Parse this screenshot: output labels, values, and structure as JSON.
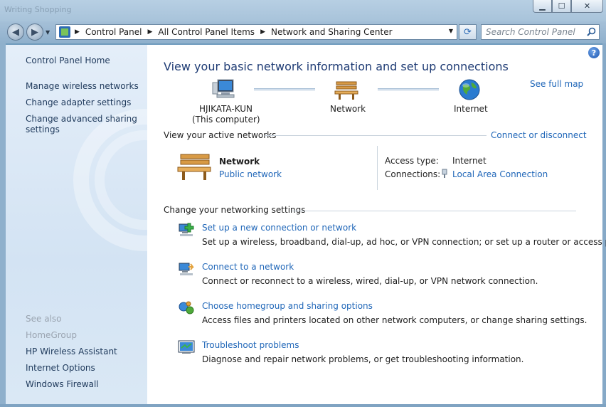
{
  "window": {
    "ghost_title": "Writing   Shopping",
    "minimize": "▁",
    "maximize": "☐",
    "close": "✕"
  },
  "nav": {
    "back": "◀",
    "forward": "▶",
    "breadcrumb": [
      "Control Panel",
      "All Control Panel Items",
      "Network and Sharing Center"
    ],
    "search_placeholder": "Search Control Panel"
  },
  "sidebar": {
    "home": "Control Panel Home",
    "tasks": [
      "Manage wireless networks",
      "Change adapter settings",
      "Change advanced sharing",
      "settings"
    ],
    "see_also_heading": "See also",
    "see_also": [
      "HomeGroup",
      "HP Wireless Assistant",
      "Internet Options",
      "Windows Firewall"
    ]
  },
  "main": {
    "title": "View your basic network information and set up connections",
    "see_full_map": "See full map",
    "map": {
      "computer_name": "HJIKATA-KUN",
      "computer_sub": "(This computer)",
      "network": "Network",
      "internet": "Internet"
    },
    "active_networks": {
      "heading": "View your active networks",
      "connect_link": "Connect or disconnect",
      "network_name": "Network",
      "network_type": "Public network",
      "access_type_label": "Access type:",
      "access_type_value": "Internet",
      "connections_label": "Connections:",
      "connections_value": "Local Area Connection"
    },
    "settings": {
      "heading": "Change your networking settings",
      "tasks": [
        {
          "title": "Set up a new connection or network",
          "desc": "Set up a wireless, broadband, dial-up, ad hoc, or VPN connection; or set up a router or access point."
        },
        {
          "title": "Connect to a network",
          "desc": "Connect or reconnect to a wireless, wired, dial-up, or VPN network connection."
        },
        {
          "title": "Choose homegroup and sharing options",
          "desc": "Access files and printers located on other network computers, or change sharing settings."
        },
        {
          "title": "Troubleshoot problems",
          "desc": "Diagnose and repair network problems, or get troubleshooting information."
        }
      ]
    }
  },
  "colors": {
    "link": "#1f66b8",
    "title": "#1e3b74",
    "sidebar_bg": "#dce9f6"
  }
}
